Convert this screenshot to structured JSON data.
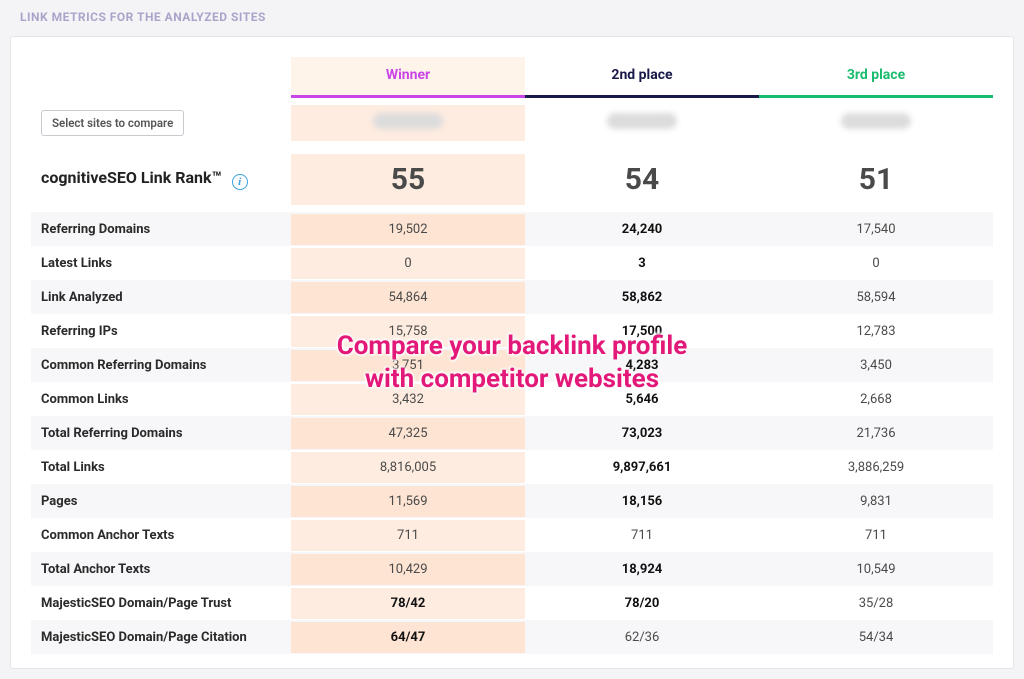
{
  "section_title": "LINK METRICS FOR THE ANALYZED SITES",
  "select_button": "Select sites to compare",
  "columns": {
    "winner": {
      "label": "Winner",
      "rank": "55"
    },
    "second": {
      "label": "2nd place",
      "rank": "54"
    },
    "third": {
      "label": "3rd place",
      "rank": "51"
    }
  },
  "rank_label": "cognitiveSEO Link Rank™",
  "metrics": [
    {
      "name": "Referring Domains",
      "w": "19,502",
      "s": "24,240",
      "t": "17,540",
      "bold": "s"
    },
    {
      "name": "Latest Links",
      "w": "0",
      "s": "3",
      "t": "0",
      "bold": "s"
    },
    {
      "name": "Link Analyzed",
      "w": "54,864",
      "s": "58,862",
      "t": "58,594",
      "bold": "s"
    },
    {
      "name": "Referring IPs",
      "w": "15,758",
      "s": "17,500",
      "t": "12,783",
      "bold": "s"
    },
    {
      "name": "Common Referring Domains",
      "w": "3,751",
      "s": "4,283",
      "t": "3,450",
      "bold": "s"
    },
    {
      "name": "Common Links",
      "w": "3,432",
      "s": "5,646",
      "t": "2,668",
      "bold": "s"
    },
    {
      "name": "Total Referring Domains",
      "w": "47,325",
      "s": "73,023",
      "t": "21,736",
      "bold": "s"
    },
    {
      "name": "Total Links",
      "w": "8,816,005",
      "s": "9,897,661",
      "t": "3,886,259",
      "bold": "s"
    },
    {
      "name": "Pages",
      "w": "11,569",
      "s": "18,156",
      "t": "9,831",
      "bold": "s"
    },
    {
      "name": "Common Anchor Texts",
      "w": "711",
      "s": "711",
      "t": "711",
      "bold": ""
    },
    {
      "name": "Total Anchor Texts",
      "w": "10,429",
      "s": "18,924",
      "t": "10,549",
      "bold": "s"
    },
    {
      "name": "MajesticSEO Domain/Page Trust",
      "w": "78/42",
      "s": "78/20",
      "t": "35/28",
      "bold": "ws"
    },
    {
      "name": "MajesticSEO Domain/Page Citation",
      "w": "64/47",
      "s": "62/36",
      "t": "54/34",
      "bold": "w"
    }
  ],
  "annotation_line1": "Compare your backlink profile",
  "annotation_line2": "with competitor websites",
  "info_glyph": "i"
}
